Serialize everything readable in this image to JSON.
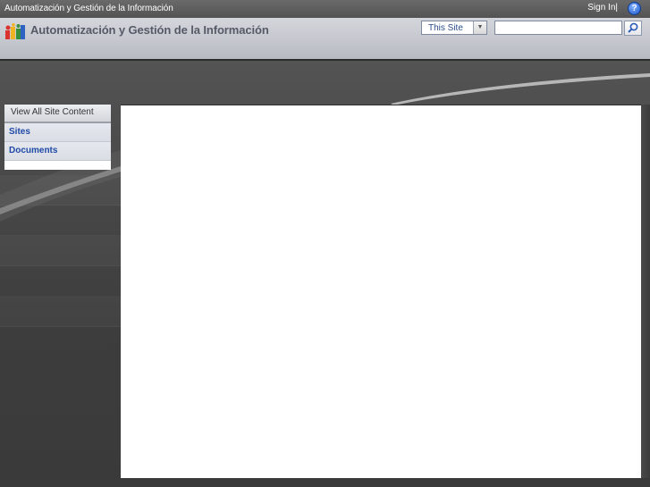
{
  "global_bar": {
    "site_link": "Automatización y Gestión de la Información",
    "sign_in": "Sign In|",
    "help_icon": "help-icon"
  },
  "header": {
    "logo_icon": "site-logo-icon",
    "title": "Automatización y Gestión de la Información"
  },
  "search": {
    "scope": "This Site",
    "scope_arrow_icon": "chevron-down-icon",
    "query": "",
    "button_icon": "search-icon"
  },
  "leftnav": {
    "view_all": "View All Site Content",
    "items": [
      {
        "label": "Sites"
      },
      {
        "label": "Documents"
      }
    ]
  },
  "colors": {
    "nav_link": "#1f4aa6",
    "title_bar": "#c4c6cd",
    "page_background": "#4a4a4a",
    "help_icon": "#1c57c9"
  }
}
